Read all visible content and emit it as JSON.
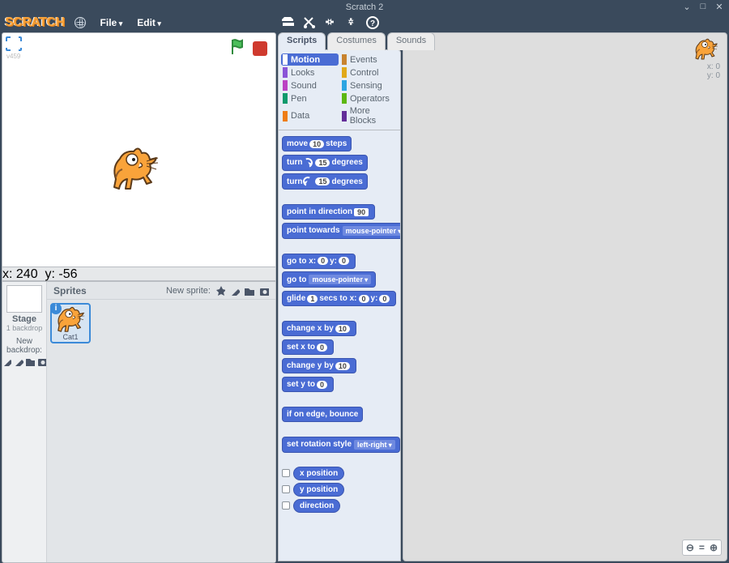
{
  "window": {
    "title": "Scratch 2"
  },
  "menu": {
    "file": "File",
    "edit": "Edit",
    "logo": "SCRATCH"
  },
  "stage": {
    "version": "v459",
    "coord_label_x": "x:",
    "coord_x": "240",
    "coord_label_y": "y:",
    "coord_y": "-56"
  },
  "sprites_panel": {
    "stage_label": "Stage",
    "stage_sub": "1 backdrop",
    "new_backdrop": "New backdrop:",
    "header": "Sprites",
    "new_sprite": "New sprite:",
    "selected_sprite": "Cat1"
  },
  "tabs": {
    "scripts": "Scripts",
    "costumes": "Costumes",
    "sounds": "Sounds"
  },
  "categories": {
    "motion": "Motion",
    "looks": "Looks",
    "sound": "Sound",
    "pen": "Pen",
    "data": "Data",
    "events": "Events",
    "control": "Control",
    "sensing": "Sensing",
    "operators": "Operators",
    "more": "More Blocks"
  },
  "colors": {
    "motion": "#4a6cd4",
    "looks": "#8a55d7",
    "sound": "#bb42c3",
    "pen": "#0e9a6c",
    "data": "#ee7d16",
    "events": "#c88330",
    "control": "#e1a91a",
    "sensing": "#2ca5e2",
    "operators": "#5cb712",
    "more": "#632d99"
  },
  "blocks": {
    "move_a": "move",
    "move_v": "10",
    "move_b": "steps",
    "turncw_a": "turn",
    "turncw_v": "15",
    "turncw_b": "degrees",
    "turnccw_a": "turn",
    "turnccw_v": "15",
    "turnccw_b": "degrees",
    "pointdir_a": "point in direction",
    "pointdir_v": "90",
    "pointto_a": "point towards",
    "pointto_v": "mouse-pointer",
    "gotoxy_a": "go to x:",
    "gotoxy_x": "0",
    "gotoxy_b": "y:",
    "gotoxy_y": "0",
    "goto_a": "go to",
    "goto_v": "mouse-pointer",
    "glide_a": "glide",
    "glide_s": "1",
    "glide_b": "secs to x:",
    "glide_x": "0",
    "glide_c": "y:",
    "glide_y": "0",
    "chx_a": "change x by",
    "chx_v": "10",
    "setx_a": "set x to",
    "setx_v": "0",
    "chy_a": "change y by",
    "chy_v": "10",
    "sety_a": "set y to",
    "sety_v": "0",
    "edge": "if on edge, bounce",
    "rot_a": "set rotation style",
    "rot_v": "left-right",
    "r_xpos": "x position",
    "r_ypos": "y position",
    "r_dir": "direction"
  },
  "script_area": {
    "x_label": "x:",
    "x": "0",
    "y_label": "y:",
    "y": "0"
  }
}
